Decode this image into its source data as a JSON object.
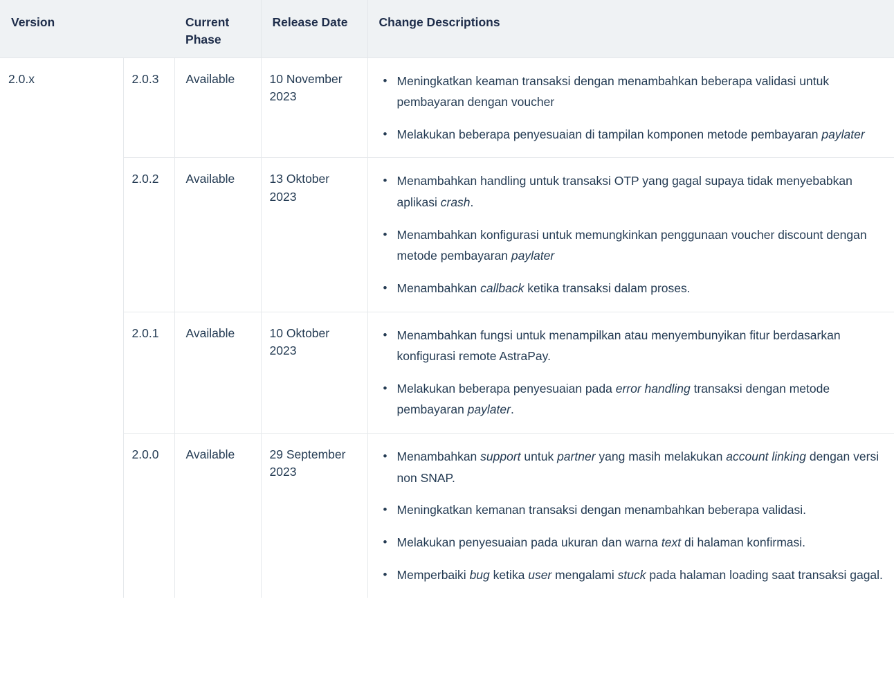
{
  "table": {
    "headers": {
      "version": "Version",
      "subversion": "",
      "current_phase": "Current Phase",
      "release_date": "Release Date",
      "change_descriptions": "Change Descriptions"
    },
    "version_group": "2.0.x",
    "rows": [
      {
        "subversion": "2.0.3",
        "phase": "Available",
        "release_date": "10 November 2023",
        "changes": [
          [
            {
              "t": "Meningkatkan keaman transaksi dengan menambahkan beberapa validasi untuk pembayaran dengan voucher",
              "i": false
            }
          ],
          [
            {
              "t": "Melakukan beberapa penyesuaian di tampilan komponen metode pembayaran ",
              "i": false
            },
            {
              "t": "paylater",
              "i": true
            }
          ]
        ]
      },
      {
        "subversion": "2.0.2",
        "phase": "Available",
        "release_date": "13 Oktober 2023",
        "changes": [
          [
            {
              "t": "Menambahkan handling untuk transaksi OTP yang gagal supaya tidak menyebabkan aplikasi ",
              "i": false
            },
            {
              "t": "crash",
              "i": true
            },
            {
              "t": ".",
              "i": false
            }
          ],
          [
            {
              "t": "Menambahkan konfigurasi untuk memungkinkan penggunaan voucher discount dengan metode pembayaran ",
              "i": false
            },
            {
              "t": "paylater",
              "i": true
            }
          ],
          [
            {
              "t": "Menambahkan ",
              "i": false
            },
            {
              "t": "callback",
              "i": true
            },
            {
              "t": " ketika transaksi dalam proses.",
              "i": false
            }
          ]
        ]
      },
      {
        "subversion": "2.0.1",
        "phase": "Available",
        "release_date": "10 Oktober 2023",
        "changes": [
          [
            {
              "t": "Menambahkan fungsi untuk menampilkan atau menyembunyikan fitur berdasarkan konfigurasi remote AstraPay.",
              "i": false
            }
          ],
          [
            {
              "t": "Melakukan beberapa penyesuaian pada ",
              "i": false
            },
            {
              "t": "error handling",
              "i": true
            },
            {
              "t": " transaksi dengan metode pembayaran ",
              "i": false
            },
            {
              "t": "paylater",
              "i": true
            },
            {
              "t": ".",
              "i": false
            }
          ]
        ]
      },
      {
        "subversion": "2.0.0",
        "phase": "Available",
        "release_date": "29 September 2023",
        "changes": [
          [
            {
              "t": "Menambahkan ",
              "i": false
            },
            {
              "t": "support",
              "i": true
            },
            {
              "t": " untuk ",
              "i": false
            },
            {
              "t": "partner",
              "i": true
            },
            {
              "t": " yang masih melakukan ",
              "i": false
            },
            {
              "t": "account linking",
              "i": true
            },
            {
              "t": " dengan versi non SNAP.",
              "i": false
            }
          ],
          [
            {
              "t": "Meningkatkan kemanan transaksi dengan menambahkan beberapa validasi.",
              "i": false
            }
          ],
          [
            {
              "t": "Melakukan penyesuaian pada ukuran dan warna ",
              "i": false
            },
            {
              "t": "text",
              "i": true
            },
            {
              "t": " di halaman konfirmasi.",
              "i": false
            }
          ],
          [
            {
              "t": "Memperbaiki ",
              "i": false
            },
            {
              "t": "bug",
              "i": true
            },
            {
              "t": " ketika ",
              "i": false
            },
            {
              "t": "user",
              "i": true
            },
            {
              "t": " mengalami ",
              "i": false
            },
            {
              "t": "stuck",
              "i": true
            },
            {
              "t": " pada halaman loading saat transaksi gagal.",
              "i": false
            }
          ]
        ]
      }
    ]
  },
  "colors": {
    "header_bg": "#eff2f4",
    "header_text": "#1e2d4a",
    "body_text": "#243b53",
    "border": "#e6e9ec"
  }
}
